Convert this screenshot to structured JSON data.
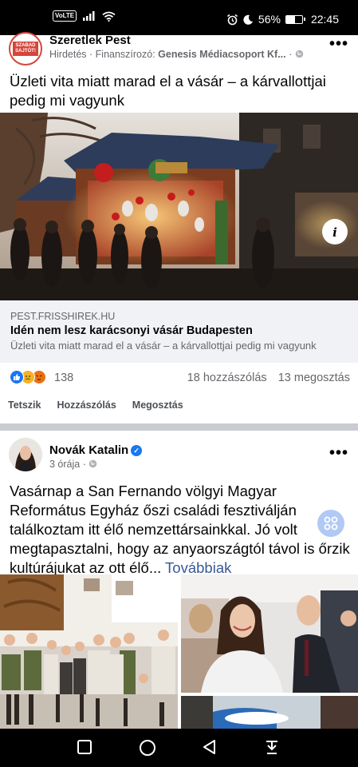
{
  "status_bar": {
    "network": "VoLTE",
    "battery": "56%",
    "time": "22:45",
    "battery_level": 0.56
  },
  "post1": {
    "author": "Szeretlek Pest",
    "avatar_text": "SZABAD SAJTÓT!",
    "meta_prefix": "Hirdetés · Finanszírozó: ",
    "sponsor": "Genesis Médiacsoport Kf...",
    "meta_suffix": " · ",
    "text": "Üzleti vita miatt marad el a vásár – a kárvallottjai pedig mi vagyunk",
    "info_icon_label": "i",
    "link": {
      "domain": "PEST.FRISSHIREK.HU",
      "title": "Idén nem lesz karácsonyi vásár Budapesten",
      "description": "Üzleti vita miatt marad el a vásár – a kárvallottjai pedig mi vagyunk"
    },
    "reaction_count": "138",
    "comments": "18 hozzászólás",
    "shares": "13 megosztás",
    "actions": {
      "like": "Tetszik",
      "comment": "Hozzászólás",
      "share": "Megosztás"
    }
  },
  "post2": {
    "author": "Novák Katalin",
    "meta": "3 órája · ",
    "text": "Vasárnap a San Fernando völgyi Magyar Református Egyház őszi családi fesztiválján találkoztam itt élő nemzettársainkkal. Jó volt megtapasztalni, hogy az anyaországtól távol is őrzik kultúrájukat az ott élő...",
    "see_more": " Továbbiak"
  },
  "colors": {
    "facebook_blue": "#1877f2",
    "link_blue": "#385898",
    "secondary_text": "#65676b",
    "card_bg": "#f0f2f5"
  }
}
